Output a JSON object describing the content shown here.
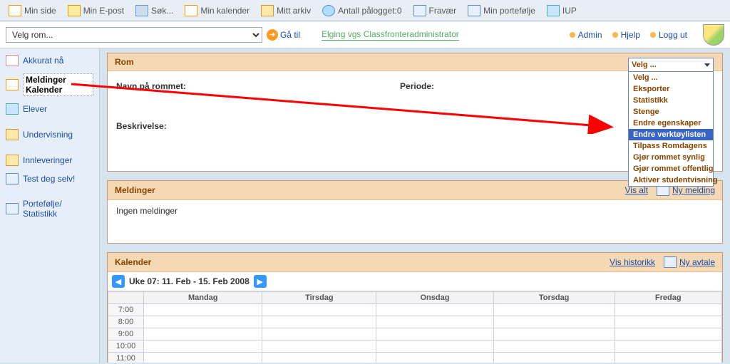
{
  "top_menu": {
    "items": [
      {
        "label": "Min side"
      },
      {
        "label": "Min E-post"
      },
      {
        "label": "Søk..."
      },
      {
        "label": "Min kalender"
      },
      {
        "label": "Mitt arkiv"
      },
      {
        "label": "Antall pålogget:0"
      },
      {
        "label": "Fravær"
      },
      {
        "label": "Min portefølje"
      },
      {
        "label": "IUP"
      }
    ]
  },
  "second_bar": {
    "room_select_value": "Velg rom...",
    "go_label": "Gå til",
    "admin_link": "Elging vgs Classfronteradministrator",
    "right": {
      "admin": "Admin",
      "help": "Hjelp",
      "logout": "Logg ut"
    }
  },
  "sidebar": {
    "items": [
      {
        "label": "Akkurat nå",
        "active": false
      },
      {
        "label": "Meldinger Kalender",
        "active": true
      },
      {
        "label": "Elever",
        "active": false
      },
      {
        "label": "Undervisning",
        "active": false
      },
      {
        "label": "Innleveringer",
        "active": false
      },
      {
        "label": "Test deg selv!",
        "active": false
      },
      {
        "label": "Portefølje/ Statistikk",
        "active": false
      }
    ]
  },
  "rom_panel": {
    "title": "Rom",
    "name_label": "Navn på rommet:",
    "period_label": "Periode:",
    "desc_label": "Beskrivelse:",
    "select_current": "Velg ...",
    "options": [
      "Velg ...",
      "Eksporter",
      "Statistikk",
      "Stenge",
      "Endre egenskaper",
      "Endre verktøylisten",
      "Tilpass Romdagens",
      "Gjør rommet synlig",
      "Gjør rommet offentlig",
      "Aktiver studentvisning"
    ],
    "highlight_index": 5
  },
  "msg_panel": {
    "title": "Meldinger",
    "view_all": "Vis alt",
    "new_msg": "Ny melding",
    "body": "Ingen meldinger"
  },
  "cal_panel": {
    "title": "Kalender",
    "history": "Vis historikk",
    "new_appt": "Ny avtale",
    "week_label": "Uke 07: 11. Feb - 15. Feb 2008",
    "days": [
      "Mandag",
      "Tirsdag",
      "Onsdag",
      "Torsdag",
      "Fredag"
    ],
    "times": [
      "7:00",
      "8:00",
      "9:00",
      "10:00",
      "11:00"
    ]
  }
}
